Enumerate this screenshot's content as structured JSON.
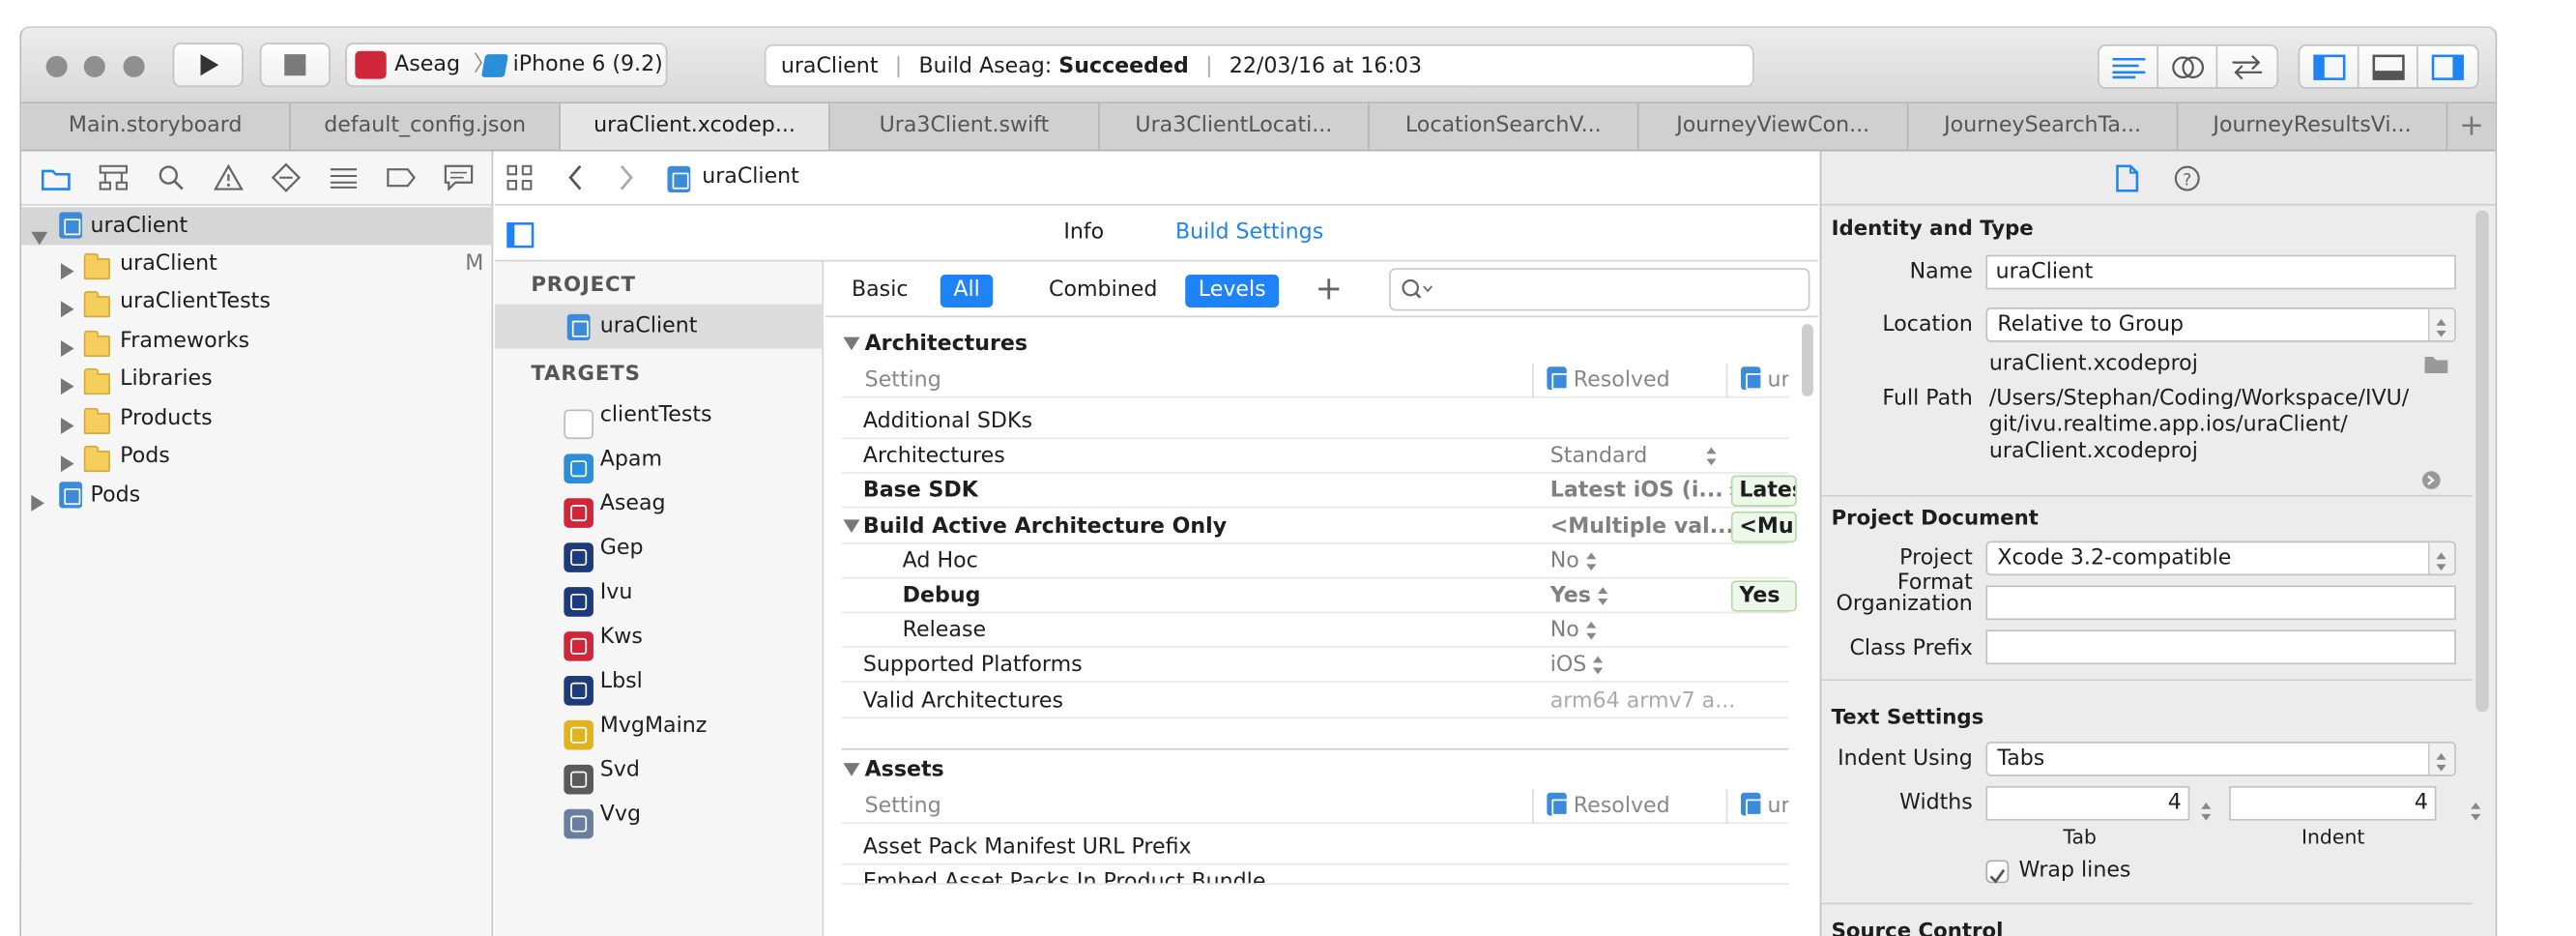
{
  "toolbar": {
    "scheme_target": "Aseag",
    "scheme_device": "iPhone 6 (9.2)",
    "status_project": "uraClient",
    "status_build": "Build Aseag:",
    "status_result": "Succeeded",
    "status_time": "22/03/16 at 16:03"
  },
  "tabs": [
    "Main.storyboard",
    "default_config.json",
    "uraClient.xcodep...",
    "Ura3Client.swift",
    "Ura3ClientLocati...",
    "LocationSearchV...",
    "JourneyViewCon...",
    "JourneySearchTa...",
    "JourneyResultsVi..."
  ],
  "navigator": {
    "root": "uraClient",
    "root_badge": "M",
    "items": [
      "uraClient",
      "uraClientTests",
      "Frameworks",
      "Libraries",
      "Products",
      "Pods"
    ],
    "second_root": "Pods"
  },
  "editor": {
    "jump_title": "uraClient",
    "tab_info": "Info",
    "tab_build_settings": "Build Settings",
    "project_header": "PROJECT",
    "project_item": "uraClient",
    "targets_header": "TARGETS",
    "targets": [
      {
        "name": "clientTests",
        "color": "#ffffff"
      },
      {
        "name": "Apam",
        "color": "#2a8ed8"
      },
      {
        "name": "Aseag",
        "color": "#d0263a"
      },
      {
        "name": "Gep",
        "color": "#1d3b7a"
      },
      {
        "name": "Ivu",
        "color": "#1d3b7a"
      },
      {
        "name": "Kws",
        "color": "#d0263a"
      },
      {
        "name": "Lbsl",
        "color": "#1d3b7a"
      },
      {
        "name": "MvgMainz",
        "color": "#e1b31f"
      },
      {
        "name": "Svd",
        "color": "#5a5a5a"
      },
      {
        "name": "Vvg",
        "color": "#6a7fa0"
      }
    ]
  },
  "build_settings": {
    "filter_basic": "Basic",
    "filter_all": "All",
    "filter_combined": "Combined",
    "filter_levels": "Levels",
    "arch_header": "Architectures",
    "col_setting": "Setting",
    "col_resolved": "Resolved",
    "col_extra": "ur",
    "rows": [
      {
        "name": "Additional SDKs",
        "value": "",
        "chip": "",
        "bold": false,
        "indent": false
      },
      {
        "name": "Architectures",
        "value": "Standard",
        "chip": "",
        "bold": false,
        "indent": false
      },
      {
        "name": "Base SDK",
        "value": "Latest iOS (i...",
        "chip": "Lates",
        "bold": true,
        "indent": false
      },
      {
        "name": "Build Active Architecture Only",
        "value": "<Multiple val...",
        "chip": "<Mu",
        "bold": true,
        "indent": false
      },
      {
        "name": "Ad Hoc",
        "value": "No",
        "chip": "",
        "bold": false,
        "indent": true
      },
      {
        "name": "Debug",
        "value": "Yes",
        "chip": "Yes",
        "bold": true,
        "indent": true
      },
      {
        "name": "Release",
        "value": "No",
        "chip": "",
        "bold": false,
        "indent": true
      },
      {
        "name": "Supported Platforms",
        "value": "iOS",
        "chip": "",
        "bold": false,
        "indent": false
      },
      {
        "name": "Valid Architectures",
        "value": "arm64 armv7 a...",
        "chip": "",
        "bold": false,
        "indent": false
      }
    ],
    "assets_header": "Assets",
    "asset_rows": [
      "Asset Pack Manifest URL Prefix",
      "Embed Asset Packs In Product Bundle"
    ]
  },
  "inspector": {
    "identity_header": "Identity and Type",
    "name_label": "Name",
    "name_value": "uraClient",
    "location_label": "Location",
    "location_value": "Relative to Group",
    "location_file": "uraClient.xcodeproj",
    "fullpath_label": "Full Path",
    "fullpath_1": "/Users/Stephan/Coding/Workspace/IVU/",
    "fullpath_2": "git/ivu.realtime.app.ios/uraClient/",
    "fullpath_3": "uraClient.xcodeproj",
    "project_doc_header": "Project Document",
    "project_format_label": "Project Format",
    "project_format_value": "Xcode 3.2-compatible",
    "organization_label": "Organization",
    "class_prefix_label": "Class Prefix",
    "text_settings_header": "Text Settings",
    "indent_using_label": "Indent Using",
    "indent_using_value": "Tabs",
    "widths_label": "Widths",
    "tab_width": "4",
    "indent_width": "4",
    "tab_caption": "Tab",
    "indent_caption": "Indent",
    "wrap_lines_label": "Wrap lines",
    "source_control_header": "Source Control"
  }
}
